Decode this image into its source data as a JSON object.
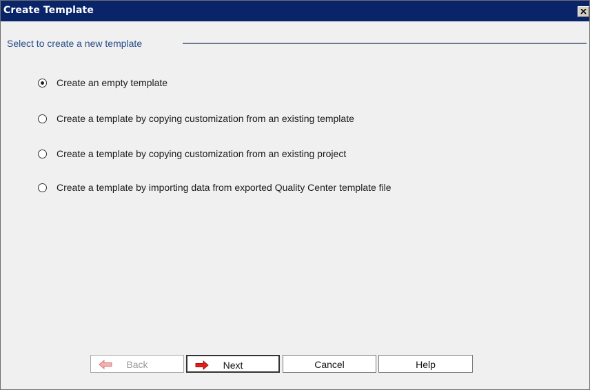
{
  "window": {
    "title": "Create Template"
  },
  "group": {
    "label": "Select to create a new template"
  },
  "options": [
    {
      "label": "Create an empty template",
      "checked": true
    },
    {
      "label": "Create a template by copying customization from an existing template",
      "checked": false
    },
    {
      "label": "Create a template by copying customization from an existing project",
      "checked": false
    },
    {
      "label": "Create a template by importing data from exported Quality Center template file",
      "checked": false
    }
  ],
  "buttons": {
    "back": "Back",
    "next": "Next",
    "cancel": "Cancel",
    "help": "Help"
  },
  "icons": {
    "close": "close-icon",
    "back": "arrow-left-icon",
    "next": "arrow-right-icon"
  },
  "colors": {
    "titlebar": "#0a246a",
    "arrow_red": "#e0201a"
  }
}
